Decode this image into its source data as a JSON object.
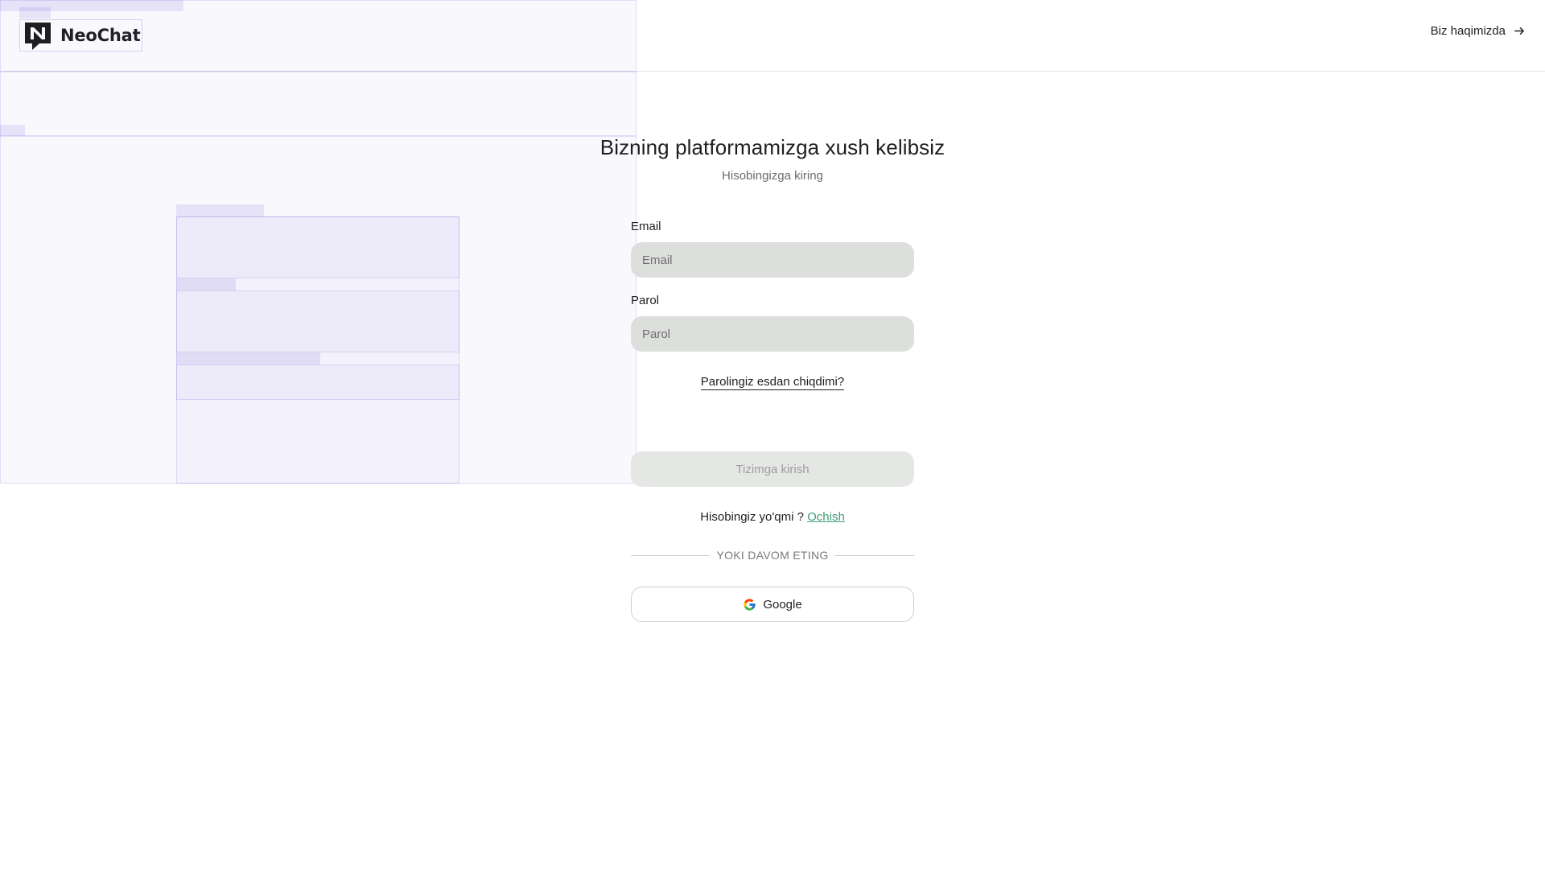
{
  "header": {
    "logo_text": "NeoChat",
    "about_label": "Biz haqimizda",
    "about_icon": "arrow-right-icon"
  },
  "auth": {
    "title": "Bizning platformamizga xush kelibsiz",
    "subtitle": "Hisobingizga kiring",
    "email": {
      "label": "Email",
      "placeholder": "Email",
      "value": ""
    },
    "password": {
      "label": "Parol",
      "placeholder": "Parol",
      "value": ""
    },
    "forgot_label": "Parolingiz esdan chiqdimi?",
    "submit_label": "Tizimga kirish",
    "signup_prompt": "Hisobingiz yo'qmi ?",
    "signup_link": "Ochish",
    "divider_text": "YOKI DAVOM ETING",
    "google_label": "Google",
    "google_icon": "google-icon"
  },
  "colors": {
    "input_bg": "#dcdfdc",
    "submit_bg": "#e5e7e5",
    "submit_text": "#9c9c9c",
    "link_green": "#3f9b74",
    "overlay": "#785adc"
  }
}
